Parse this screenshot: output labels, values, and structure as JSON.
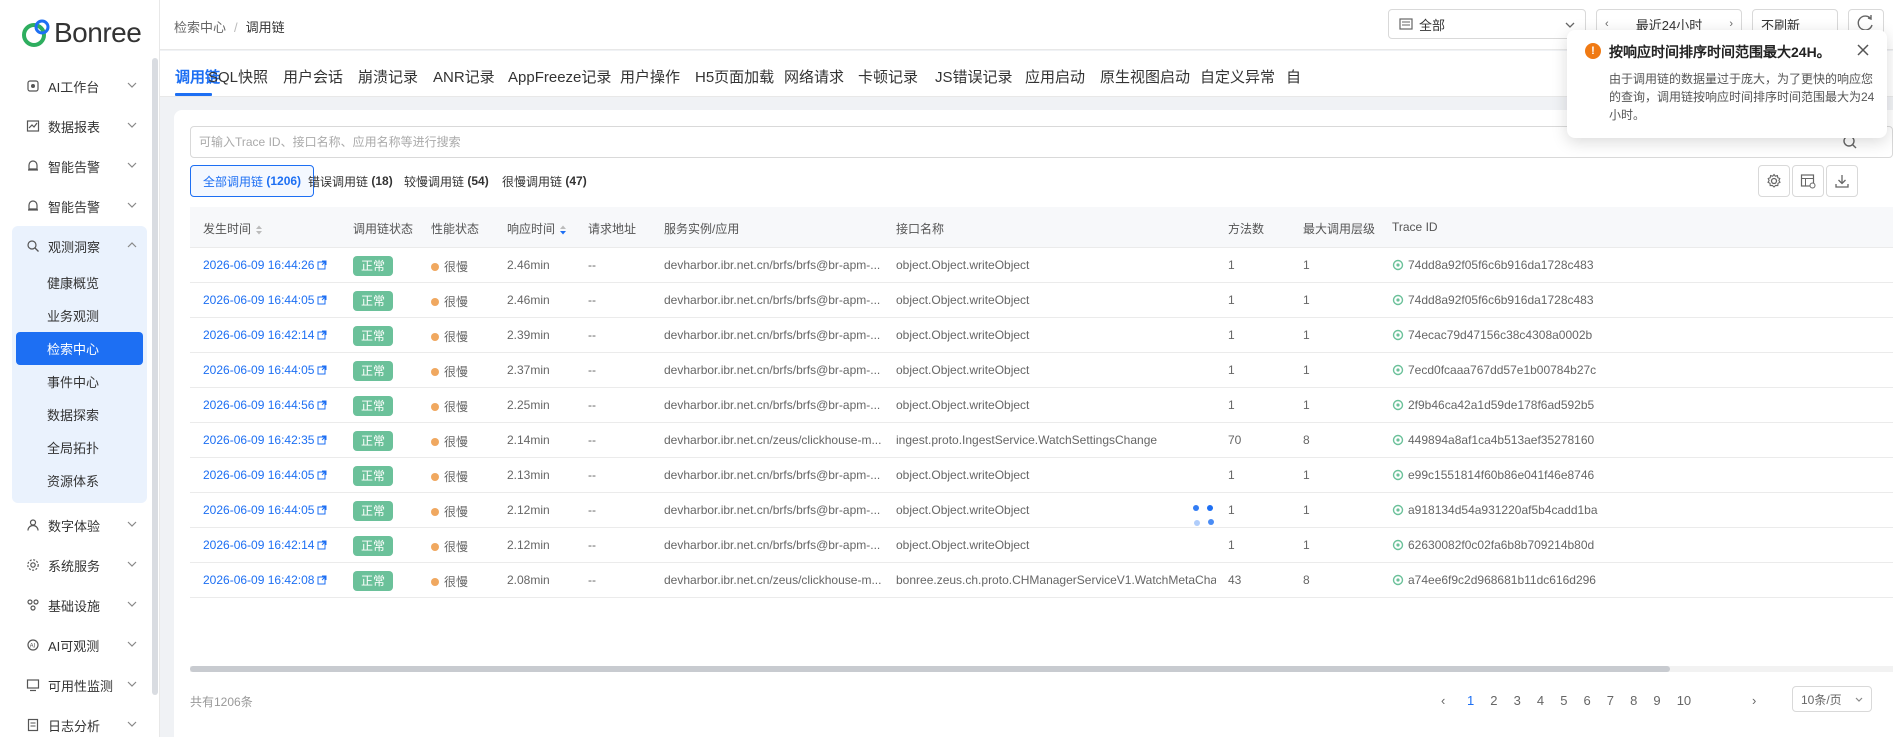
{
  "app": {
    "logo_text": "Bonree",
    "accent": "#1d6ff3"
  },
  "sidebar": {
    "items": [
      {
        "label": "AI工作台",
        "icon": "ai-icon"
      },
      {
        "label": "数据报表",
        "icon": "chart-icon"
      },
      {
        "label": "智能告警",
        "icon": "alarm-icon"
      },
      {
        "label": "智能告警",
        "icon": "alarm-icon"
      },
      {
        "label": "观测洞察",
        "icon": "observe-icon"
      },
      {
        "label": "数字体验",
        "icon": "user-icon"
      },
      {
        "label": "系统服务",
        "icon": "service-icon"
      },
      {
        "label": "基础设施",
        "icon": "infra-icon"
      },
      {
        "label": "AI可观测",
        "icon": "ai-observe-icon"
      },
      {
        "label": "可用性监测",
        "icon": "monitor-icon"
      },
      {
        "label": "日志分析",
        "icon": "log-icon"
      }
    ],
    "sub_items": [
      "健康概览",
      "业务观测",
      "检索中心",
      "事件中心",
      "数据探索",
      "全局拓扑",
      "资源体系"
    ]
  },
  "header": {
    "breadcrumb": [
      "检索中心",
      "调用链"
    ],
    "select_value": "全部",
    "time_range": "最近24小时",
    "refresh": "不刷新"
  },
  "tabs": [
    "调用链",
    "SQL快照",
    "用户会话",
    "崩溃记录",
    "ANR记录",
    "AppFreeze记录",
    "用户操作",
    "H5页面加载",
    "网络请求",
    "卡顿记录",
    "JS错误记录",
    "应用启动",
    "原生视图启动",
    "自定义异常",
    "自"
  ],
  "search": {
    "placeholder": "可输入Trace ID、接口名称、应用名称等进行搜索"
  },
  "segments": [
    {
      "label": "全部调用链",
      "count": "(1206)"
    },
    {
      "label": "错误调用链",
      "count": "(18)"
    },
    {
      "label": "较慢调用链",
      "count": "(54)"
    },
    {
      "label": "很慢调用链",
      "count": "(47)"
    }
  ],
  "table": {
    "columns": [
      "发生时间",
      "调用链状态",
      "性能状态",
      "响应时间",
      "请求地址",
      "服务实例/应用",
      "接口名称",
      "方法数",
      "最大调用层级",
      "Trace ID"
    ],
    "rows": [
      {
        "time": "2026-06-09 16:44:26",
        "status": "正常",
        "perf": "很慢",
        "resp": "2.46min",
        "addr": "--",
        "service": "devharbor.ibr.net.cn/brfs/brfs@br-apm-...",
        "api": "object.Object.writeObject",
        "methods": "1",
        "depth": "1",
        "trace": "74dd8a92f05f6c6b916da1728c483"
      },
      {
        "time": "2026-06-09 16:44:05",
        "status": "正常",
        "perf": "很慢",
        "resp": "2.46min",
        "addr": "--",
        "service": "devharbor.ibr.net.cn/brfs/brfs@br-apm-...",
        "api": "object.Object.writeObject",
        "methods": "1",
        "depth": "1",
        "trace": "74dd8a92f05f6c6b916da1728c483"
      },
      {
        "time": "2026-06-09 16:42:14",
        "status": "正常",
        "perf": "很慢",
        "resp": "2.39min",
        "addr": "--",
        "service": "devharbor.ibr.net.cn/brfs/brfs@br-apm-...",
        "api": "object.Object.writeObject",
        "methods": "1",
        "depth": "1",
        "trace": "74ecac79d47156c38c4308a0002b"
      },
      {
        "time": "2026-06-09 16:44:05",
        "status": "正常",
        "perf": "很慢",
        "resp": "2.37min",
        "addr": "--",
        "service": "devharbor.ibr.net.cn/brfs/brfs@br-apm-...",
        "api": "object.Object.writeObject",
        "methods": "1",
        "depth": "1",
        "trace": "7ecd0fcaaa767dd57e1b00784b27c"
      },
      {
        "time": "2026-06-09 16:44:56",
        "status": "正常",
        "perf": "很慢",
        "resp": "2.25min",
        "addr": "--",
        "service": "devharbor.ibr.net.cn/brfs/brfs@br-apm-...",
        "api": "object.Object.writeObject",
        "methods": "1",
        "depth": "1",
        "trace": "2f9b46ca42a1d59de178f6ad592b5"
      },
      {
        "time": "2026-06-09 16:42:35",
        "status": "正常",
        "perf": "很慢",
        "resp": "2.14min",
        "addr": "--",
        "service": "devharbor.ibr.net.cn/zeus/clickhouse-m...",
        "api": "ingest.proto.IngestService.WatchSettingsChange",
        "methods": "70",
        "depth": "8",
        "trace": "449894a8af1ca4b513aef35278160"
      },
      {
        "time": "2026-06-09 16:44:05",
        "status": "正常",
        "perf": "很慢",
        "resp": "2.13min",
        "addr": "--",
        "service": "devharbor.ibr.net.cn/brfs/brfs@br-apm-...",
        "api": "object.Object.writeObject",
        "methods": "1",
        "depth": "1",
        "trace": "e99c1551814f60b86e041f46e8746"
      },
      {
        "time": "2026-06-09 16:44:05",
        "status": "正常",
        "perf": "很慢",
        "resp": "2.12min",
        "addr": "--",
        "service": "devharbor.ibr.net.cn/brfs/brfs@br-apm-...",
        "api": "object.Object.writeObject",
        "methods": "1",
        "depth": "1",
        "trace": "a918134d54a931220af5b4cadd1ba"
      },
      {
        "time": "2026-06-09 16:42:14",
        "status": "正常",
        "perf": "很慢",
        "resp": "2.12min",
        "addr": "--",
        "service": "devharbor.ibr.net.cn/brfs/brfs@br-apm-...",
        "api": "object.Object.writeObject",
        "methods": "1",
        "depth": "1",
        "trace": "62630082f0c02fa6b8b709214b80d"
      },
      {
        "time": "2026-06-09 16:42:08",
        "status": "正常",
        "perf": "很慢",
        "resp": "2.08min",
        "addr": "--",
        "service": "devharbor.ibr.net.cn/zeus/clickhouse-m...",
        "api": "bonree.zeus.ch.proto.CHManagerServiceV1.WatchMetaCha...",
        "methods": "43",
        "depth": "8",
        "trace": "a74ee6f9c2d968681b11dc616d296"
      }
    ]
  },
  "footer": {
    "total": "共有1206条",
    "pages": [
      "1",
      "2",
      "3",
      "4",
      "5",
      "6",
      "7",
      "8",
      "9",
      "10"
    ],
    "current_page": "1",
    "page_size": "10条/页"
  },
  "notice": {
    "title": "按响应时间排序时间范围最大24H。",
    "body": "由于调用链的数据量过于庞大，为了更快的响应您的查询，调用链按响应时间排序时间范围最大为24小时。"
  }
}
